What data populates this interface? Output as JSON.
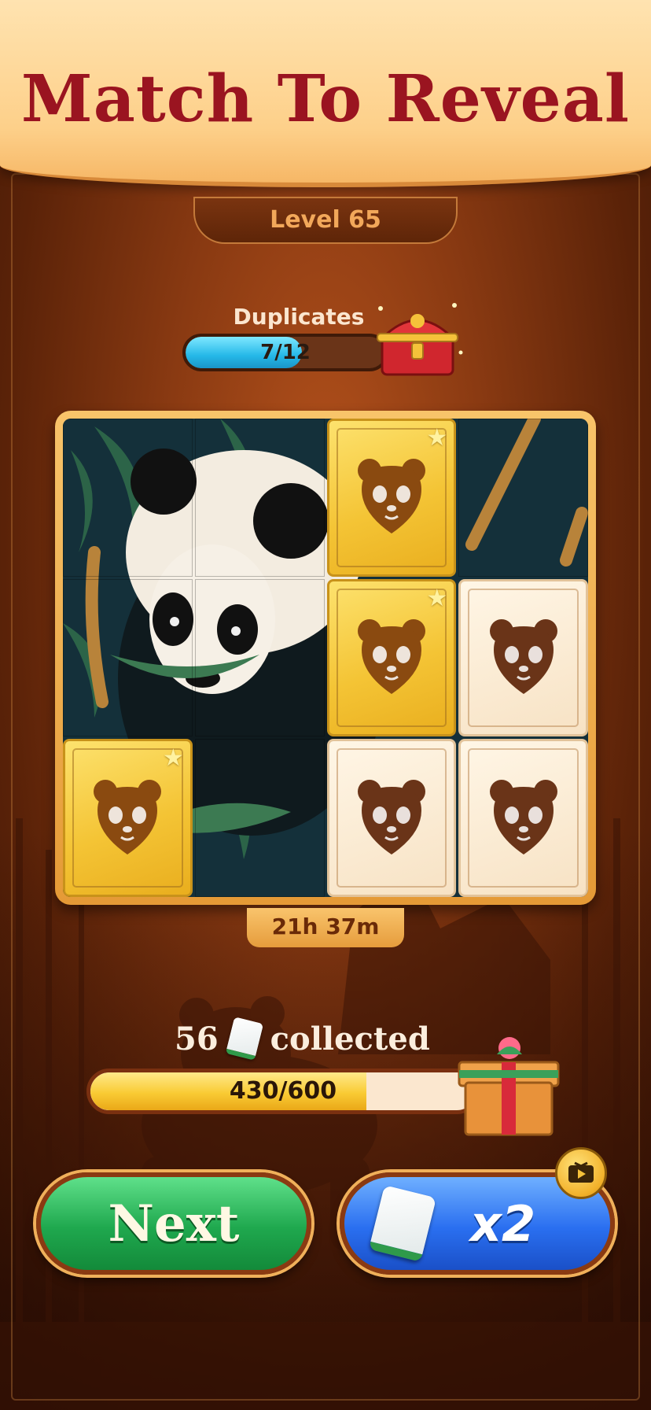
{
  "header": {
    "title": "Match To Reveal",
    "level_label": "Level 65"
  },
  "duplicates": {
    "label": "Duplicates",
    "current": 7,
    "total": 12,
    "text": "7/12",
    "progress": 0.583,
    "reward_icon": "treasure-chest-icon"
  },
  "board": {
    "rows": 3,
    "cols": 4,
    "revealed_image": "panda-in-bamboo",
    "tiles": [
      {
        "row": 0,
        "col": 0,
        "state": "revealed"
      },
      {
        "row": 0,
        "col": 1,
        "state": "revealed"
      },
      {
        "row": 0,
        "col": 2,
        "state": "gold",
        "starred": true
      },
      {
        "row": 0,
        "col": 3,
        "state": "revealed"
      },
      {
        "row": 1,
        "col": 0,
        "state": "revealed"
      },
      {
        "row": 1,
        "col": 1,
        "state": "revealed"
      },
      {
        "row": 1,
        "col": 2,
        "state": "gold",
        "starred": true
      },
      {
        "row": 1,
        "col": 3,
        "state": "cream",
        "starred": false
      },
      {
        "row": 2,
        "col": 0,
        "state": "gold",
        "starred": true
      },
      {
        "row": 2,
        "col": 1,
        "state": "revealed"
      },
      {
        "row": 2,
        "col": 2,
        "state": "cream",
        "starred": false
      },
      {
        "row": 2,
        "col": 3,
        "state": "cream",
        "starred": false
      }
    ],
    "tile_icon": "panda-face-icon",
    "star_icon": "star-icon",
    "timer": "21h 37m"
  },
  "collected": {
    "count": "56",
    "label": "collected",
    "icon": "mahjong-tile-icon"
  },
  "progress": {
    "current": 430,
    "goal": 600,
    "text": "430/600",
    "fraction": 0.717,
    "reward_icon": "gift-box-icon"
  },
  "buttons": {
    "next_label": "Next",
    "multiplier_label": "x2",
    "video_icon": "play-video-icon"
  },
  "colors": {
    "title_red": "#9a1420",
    "gold_tile": "#f4c435",
    "cream_tile": "#f7e2c4",
    "next_green": "#1fa84e",
    "x2_blue": "#2a6ff0"
  }
}
